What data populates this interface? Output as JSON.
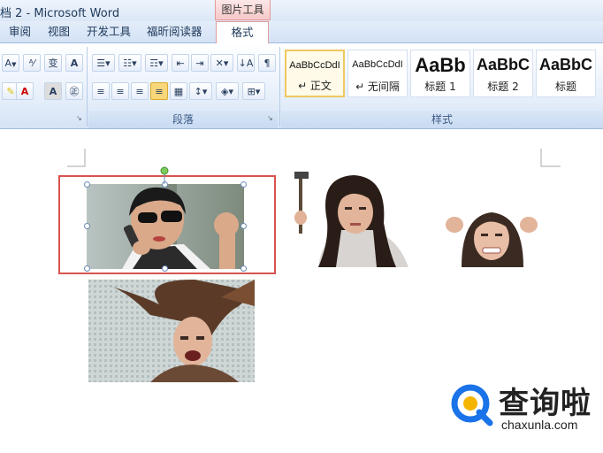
{
  "window": {
    "title": "档 2 - Microsoft Word",
    "context_tab_group": "图片工具"
  },
  "tabs": [
    {
      "label": "审阅"
    },
    {
      "label": "视图"
    },
    {
      "label": "开发工具"
    },
    {
      "label": "福昕阅读器"
    },
    {
      "label": "格式"
    }
  ],
  "ribbon": {
    "paragraph_group_label": "段落",
    "styles_group_label": "样式",
    "styles": [
      {
        "preview": "AaBbCcDdI",
        "name": "↵ 正文",
        "selected": true
      },
      {
        "preview": "AaBbCcDdI",
        "name": "↵ 无间隔",
        "selected": false
      },
      {
        "preview": "AaBb",
        "name": "标题 1",
        "selected": false
      },
      {
        "preview": "AaBbC",
        "name": "标题 2",
        "selected": false
      },
      {
        "preview": "AaBbC",
        "name": "标题",
        "selected": false
      }
    ],
    "accent_color": "#d9534f"
  },
  "watermark": {
    "cn": "查询啦",
    "en": "chaxunla.com",
    "color": "#1a73e8"
  }
}
